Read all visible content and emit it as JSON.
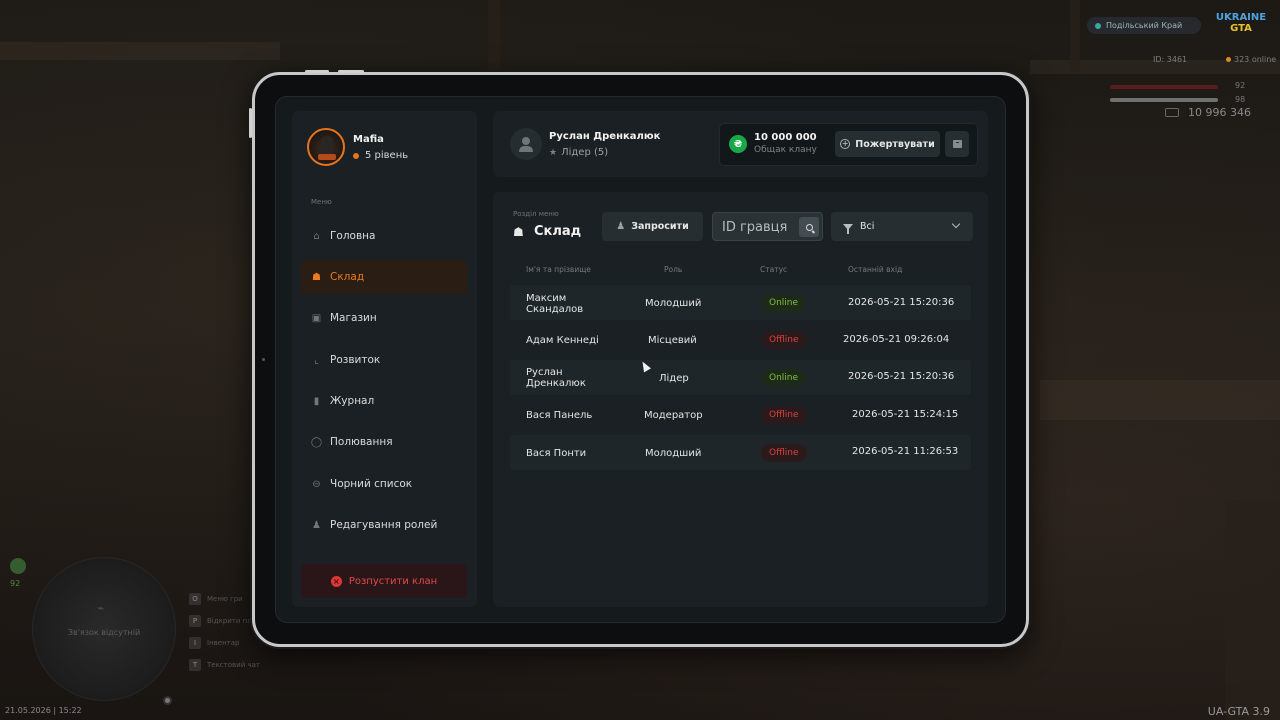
{
  "hud": {
    "server_name": "Подільський Край",
    "logo_line1": "UKRAINE",
    "logo_line2": "GTA",
    "player_id": "ID: 3461",
    "online": "323 online",
    "health": "92",
    "armor": "98",
    "money": "10 996 346",
    "minimap_text": "Зв'язок відсутній",
    "minimap_number": "92",
    "datetime": "21.05.2026 | 15:22",
    "keys": [
      {
        "key": "O",
        "label": "Меню гри"
      },
      {
        "key": "P",
        "label": "Відкрити планшет"
      },
      {
        "key": "I",
        "label": "Інвентар"
      },
      {
        "key": "T",
        "label": "Текстовий чат"
      }
    ],
    "version": "UA-GTA 3.9"
  },
  "sidebar": {
    "clan_name": "Mafia",
    "clan_level": "5 рівень",
    "menu_caption": "Меню",
    "items": [
      {
        "label": "Головна",
        "icon": "home-icon",
        "active": false
      },
      {
        "label": "Склад",
        "icon": "people-icon",
        "active": true
      },
      {
        "label": "Магазин",
        "icon": "cart-icon",
        "active": false
      },
      {
        "label": "Розвиток",
        "icon": "chart-icon",
        "active": false
      },
      {
        "label": "Журнал",
        "icon": "book-icon",
        "active": false
      },
      {
        "label": "Полювання",
        "icon": "target-icon",
        "active": false
      },
      {
        "label": "Чорний список",
        "icon": "block-icon",
        "active": false
      },
      {
        "label": "Редагування ролей",
        "icon": "user-edit-icon",
        "active": false
      }
    ],
    "disband_label": "Розпустити клан"
  },
  "header": {
    "user_name": "Руслан Дренкалюк",
    "user_role": "Лідер (5)",
    "bank_amount": "10 000 000",
    "bank_label": "Общак клану",
    "donate_label": "Пожертвувати"
  },
  "main": {
    "section_caption": "Розділ меню",
    "section_title": "Склад",
    "invite_label": "Запросити",
    "search_placeholder": "ID гравця",
    "filter_value": "Всі",
    "columns": [
      "Ім'я та прізвище",
      "Роль",
      "Статус",
      "Останній вхід"
    ],
    "rows": [
      {
        "name_line1": "Максим",
        "name_line2": "Скандалов",
        "role": "Молодший",
        "status": "Online",
        "last_login": "2026-05-21 15:20:36"
      },
      {
        "name_line1": "Адам Кеннеді",
        "name_line2": "",
        "role": "Місцевий",
        "status": "Offline",
        "last_login": "2026-05-21 09:26:04"
      },
      {
        "name_line1": "Руслан",
        "name_line2": "Дренкалюк",
        "role": "Лідер",
        "status": "Online",
        "last_login": "2026-05-21 15:20:36"
      },
      {
        "name_line1": "Вася Панель",
        "name_line2": "",
        "role": "Модератор",
        "status": "Offline",
        "last_login": "2026-05-21 15:24:15"
      },
      {
        "name_line1": "Вася Понти",
        "name_line2": "",
        "role": "Молодший",
        "status": "Offline",
        "last_login": "2026-05-21 11:26:53"
      }
    ]
  },
  "colors": {
    "accent": "#ee7b1f",
    "online": "#7ec13a",
    "offline": "#d9413d",
    "coin": "#18a84a"
  }
}
